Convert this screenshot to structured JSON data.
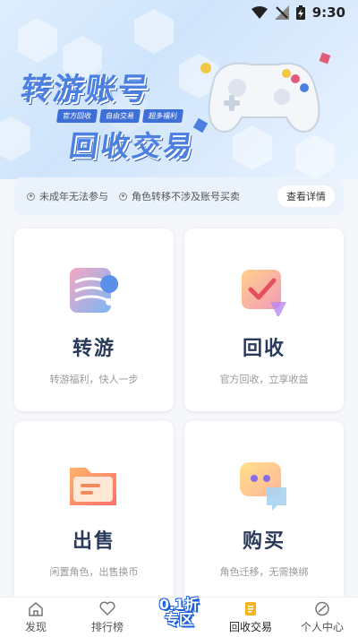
{
  "status_bar": {
    "time": "9:30"
  },
  "banner": {
    "title_line1": "转游账号",
    "title_line2": "回收交易",
    "tags": [
      "官方回收",
      "自由交易",
      "超多福利"
    ]
  },
  "notice": {
    "items": [
      "未成年无法参与",
      "角色转移不涉及账号买卖"
    ],
    "button_label": "查看详情"
  },
  "cards": [
    {
      "title": "转游",
      "subtitle": "转游福利，快人一步",
      "icon": "transfer-icon"
    },
    {
      "title": "回收",
      "subtitle": "官方回收，立享收益",
      "icon": "recycle-icon"
    },
    {
      "title": "出售",
      "subtitle": "闲置角色，出售换币",
      "icon": "sell-folder-icon"
    },
    {
      "title": "购买",
      "subtitle": "角色迁移，无需换绑",
      "icon": "buy-chat-icon"
    }
  ],
  "bottom_nav": {
    "items": [
      {
        "label": "发现",
        "icon": "home-icon"
      },
      {
        "label": "排行榜",
        "icon": "heart-icon"
      },
      {
        "label": "回收交易",
        "icon": "trade-doc-icon",
        "active": true
      },
      {
        "label": "个人中心",
        "icon": "user-center-icon"
      }
    ],
    "center_badge": {
      "line1": "0.1折",
      "line2": "专区"
    }
  },
  "colors": {
    "accent": "#4b7fe0",
    "background": "#f5f7fa",
    "notice_bg": "#eaf3fc"
  }
}
